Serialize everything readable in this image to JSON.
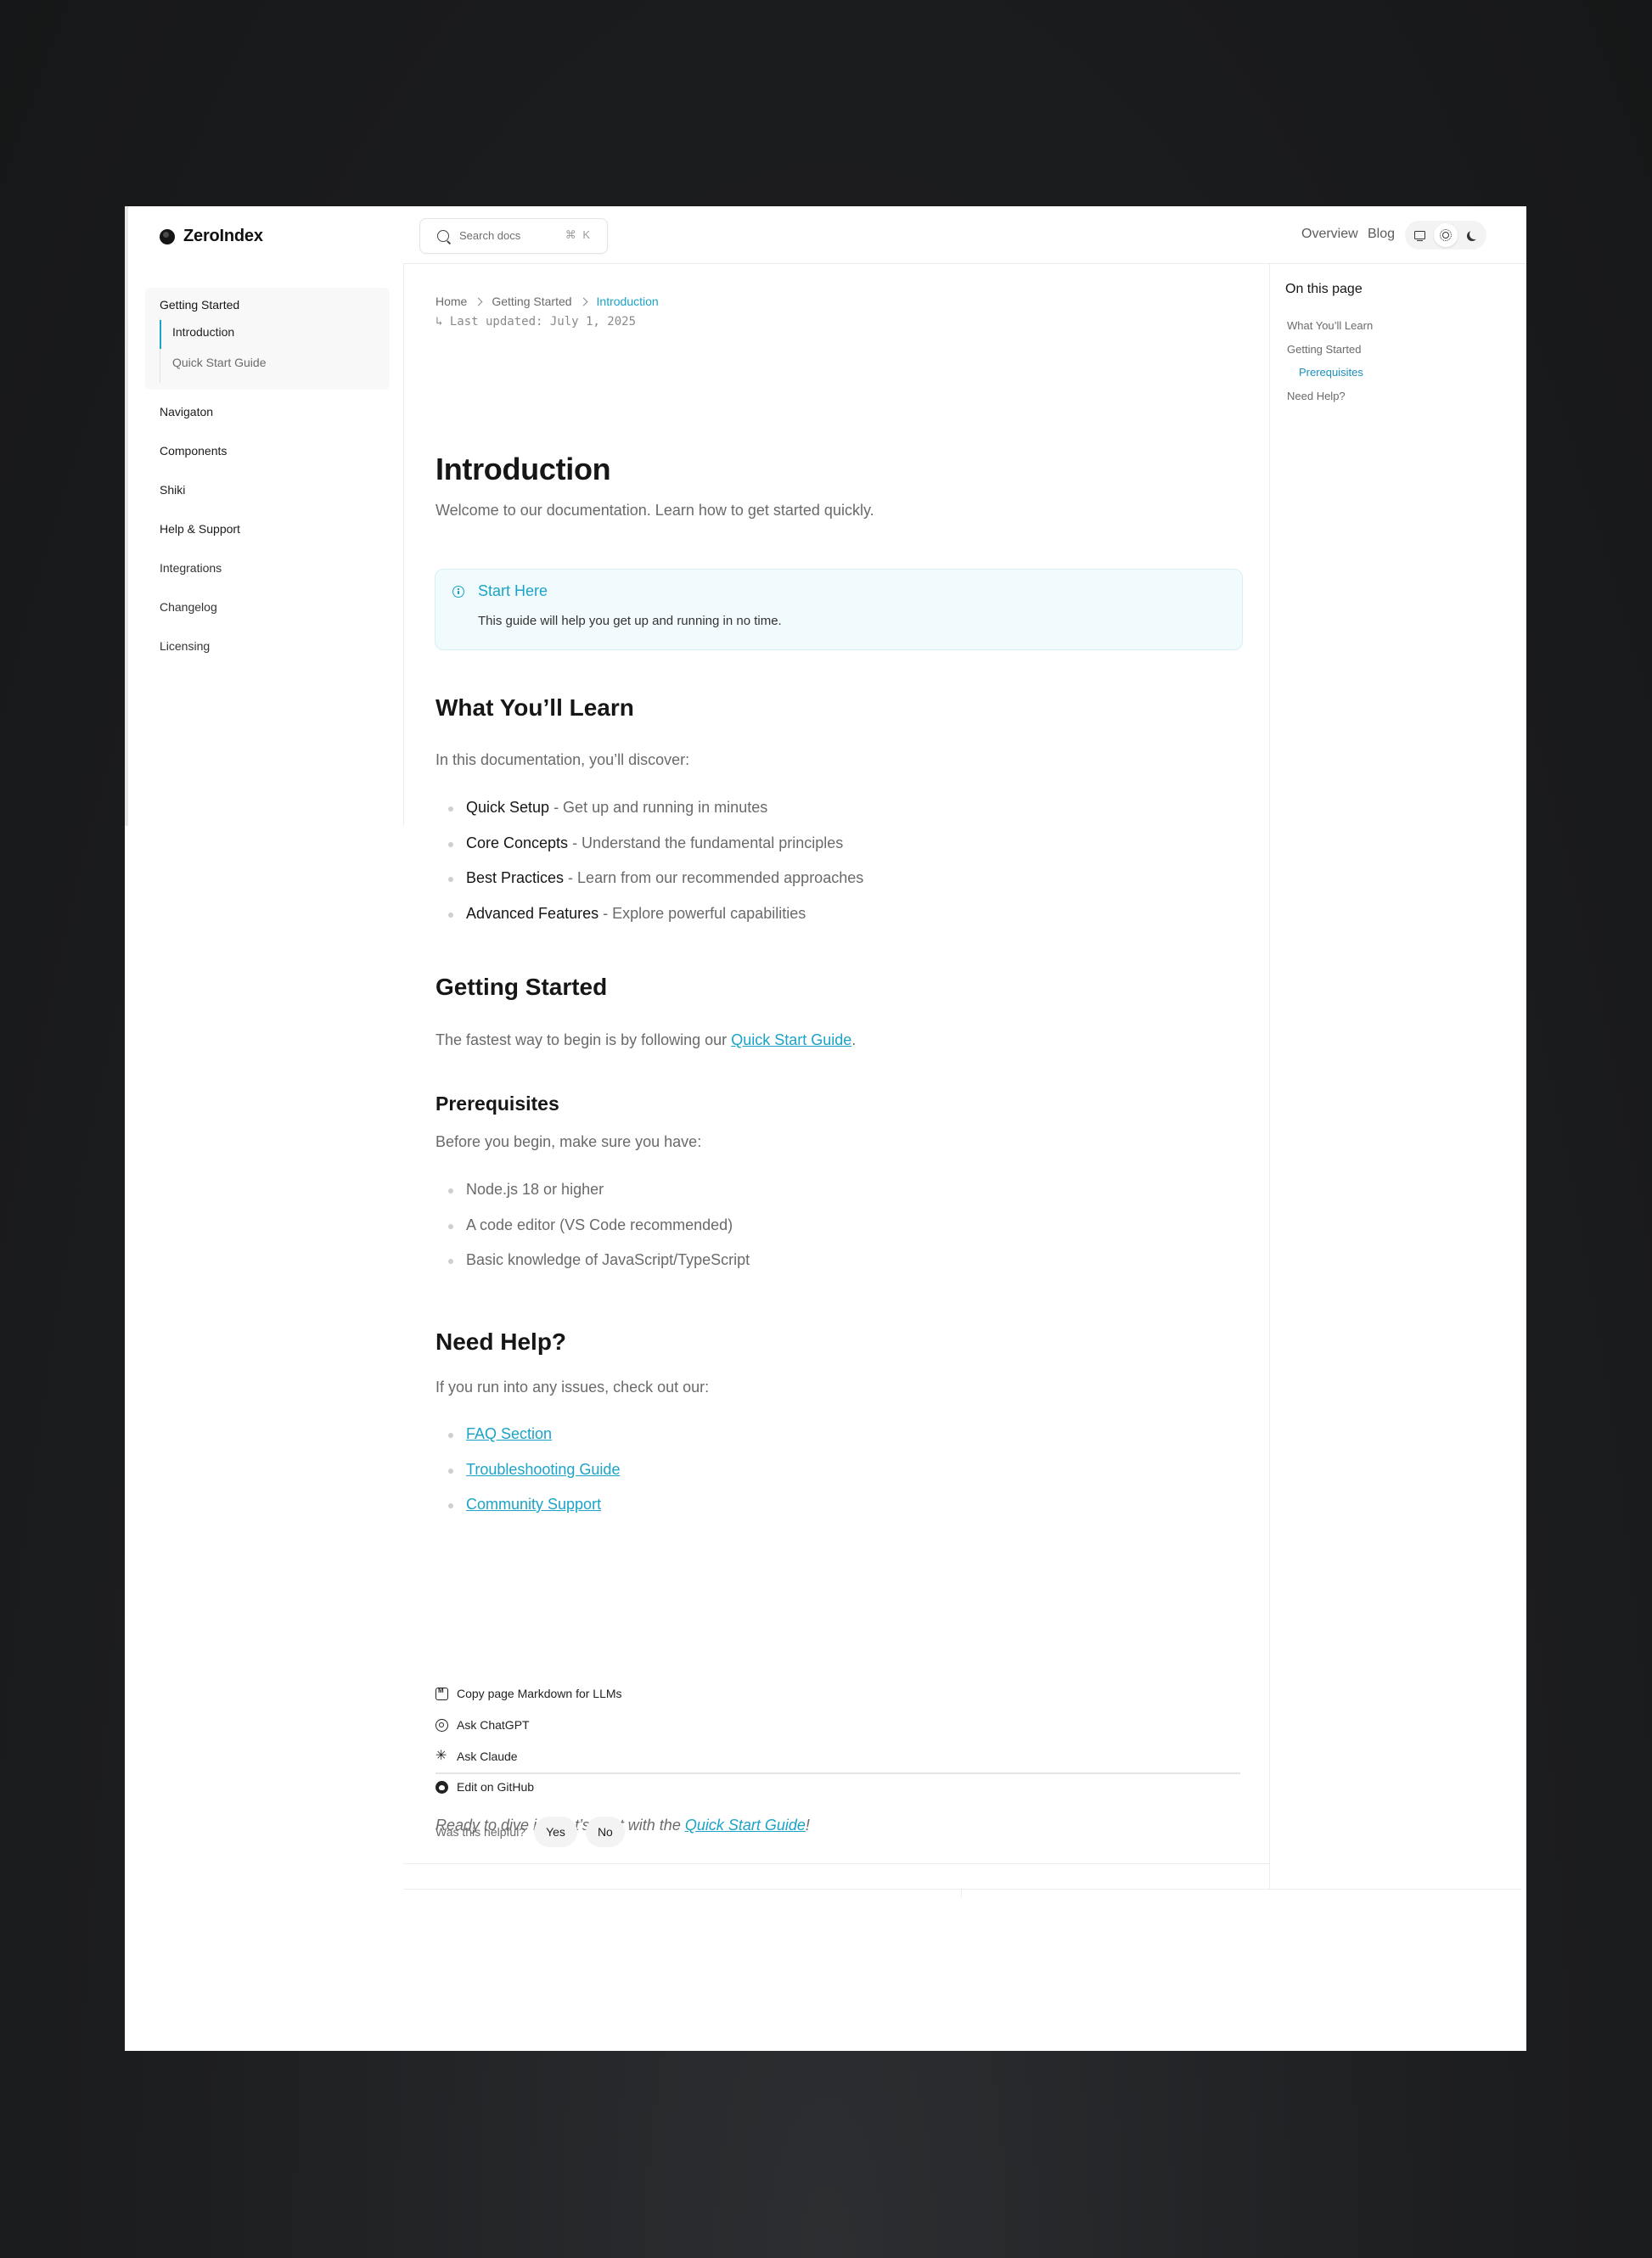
{
  "brand": {
    "name": "ZeroIndex"
  },
  "sidebar": {
    "group": {
      "title": "Getting Started",
      "items": [
        {
          "label": "Introduction",
          "active": true
        },
        {
          "label": "Quick Start Guide",
          "active": false
        }
      ]
    },
    "items": [
      {
        "label": "Navigaton"
      },
      {
        "label": "Components"
      },
      {
        "label": "Shiki"
      },
      {
        "label": "Help & Support"
      },
      {
        "label": "Integrations"
      },
      {
        "label": "Changelog"
      },
      {
        "label": "Licensing"
      }
    ]
  },
  "topbar": {
    "search": {
      "placeholder": "Search docs",
      "shortcut": "⌘ K"
    },
    "links": [
      {
        "label": "Overview"
      },
      {
        "label": "Blog"
      }
    ],
    "theme": {
      "options": [
        "monitor-icon",
        "sun-icon",
        "moon-icon"
      ],
      "selected": "sun-icon"
    }
  },
  "breadcrumb": {
    "items": [
      "Home",
      "Getting Started"
    ],
    "current": "Introduction"
  },
  "last_updated": "↳ Last updated: July 1, 2025",
  "page": {
    "title": "Introduction",
    "lead": "Welcome to our documentation. Learn how to get started quickly.",
    "callout": {
      "title": "Start Here",
      "body": "This guide will help you get up and running in no time."
    },
    "learn": {
      "heading": "What You’ll Learn",
      "intro": "In this documentation, you’ll discover:",
      "items": [
        {
          "term": "Quick Setup",
          "desc": " - Get up and running in minutes"
        },
        {
          "term": "Core Concepts",
          "desc": " - Understand the fundamental principles"
        },
        {
          "term": "Best Practices",
          "desc": " - Learn from our recommended approaches"
        },
        {
          "term": "Advanced Features",
          "desc": " - Explore powerful capabilities"
        }
      ]
    },
    "getting_started": {
      "heading": "Getting Started",
      "text_before": "The fastest way to begin is by following our ",
      "link": "Quick Start Guide",
      "text_after": "."
    },
    "prereq": {
      "heading": "Prerequisites",
      "intro": "Before you begin, make sure you have:",
      "items": [
        "Node.js 18 or higher",
        "A code editor (VS Code recommended)",
        "Basic knowledge of JavaScript/TypeScript"
      ]
    },
    "help": {
      "heading": "Need Help?",
      "intro": "If you run into any issues, check out our:",
      "links": [
        "FAQ Section",
        "Troubleshooting Guide",
        "Community Support"
      ]
    },
    "closing": {
      "text_before": "Ready to dive in? Let’s start with the ",
      "link": "Quick Start Guide",
      "text_after": "!"
    }
  },
  "footer": {
    "actions": [
      {
        "label": "Copy page Markdown for LLMs",
        "icon": "markdown-icon"
      },
      {
        "label": "Ask ChatGPT",
        "icon": "chatgpt-icon"
      },
      {
        "label": "Ask Claude",
        "icon": "claude-icon"
      },
      {
        "label": "Edit on GitHub",
        "icon": "github-icon"
      }
    ],
    "helpful": {
      "label": "Was this helpful?",
      "yes": "Yes",
      "no": "No"
    }
  },
  "toc": {
    "title": "On this page",
    "items": [
      {
        "label": "What You’ll Learn",
        "active": false
      },
      {
        "label": "Getting Started",
        "active": false
      },
      {
        "label": "Prerequisites",
        "active": true
      },
      {
        "label": "Need Help?",
        "active": false
      }
    ]
  },
  "colors": {
    "accent": "#1ba3c8",
    "callout_bg": "#f1fbfd",
    "background": "#1d1e20"
  }
}
